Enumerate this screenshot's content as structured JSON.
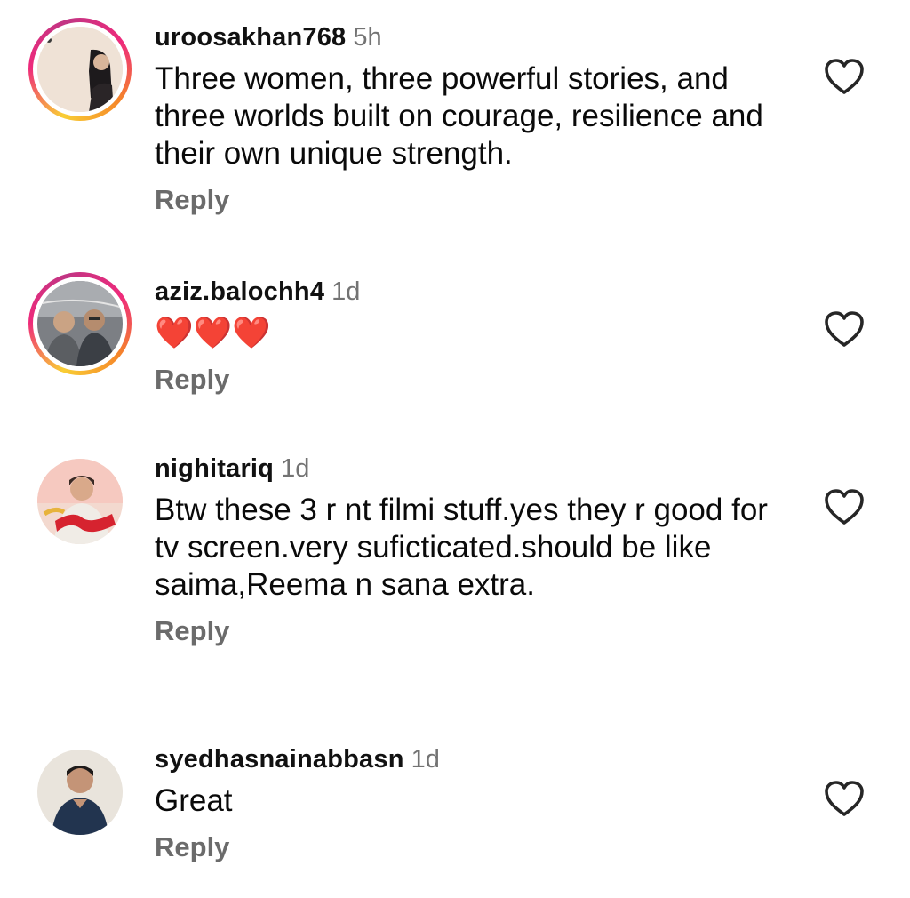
{
  "comments": [
    {
      "username": "uroosakhan768",
      "time": "5h",
      "text": "Three women, three powerful stories, and three worlds built on courage, resilience and their own unique strength.",
      "reply_label": "Reply",
      "has_story_ring": true,
      "avatar_icon": "avatar-photo"
    },
    {
      "username": "aziz.balochh4",
      "time": "1d",
      "text": "❤️❤️❤️",
      "reply_label": "Reply",
      "has_story_ring": true,
      "avatar_icon": "avatar-photo"
    },
    {
      "username": "nighitariq",
      "time": "1d",
      "text": "Btw these 3 r nt filmi stuff.yes they r good for tv screen.very suficticated.should be like saima,Reema n sana extra.",
      "reply_label": "Reply",
      "has_story_ring": false,
      "avatar_icon": "avatar-photo"
    },
    {
      "username": "syedhasnainabbasn",
      "time": "1d",
      "text": "Great",
      "reply_label": "Reply",
      "has_story_ring": false,
      "avatar_icon": "avatar-photo"
    }
  ],
  "icons": {
    "like": "heart-outline-icon"
  },
  "colors": {
    "secondary_text": "#737373",
    "reply_text": "#6b6b6b",
    "ring_gradient": [
      "#f9ce34",
      "#ee2a7b",
      "#c13584",
      "#f58529"
    ],
    "heart_emoji": "#e0202e"
  }
}
